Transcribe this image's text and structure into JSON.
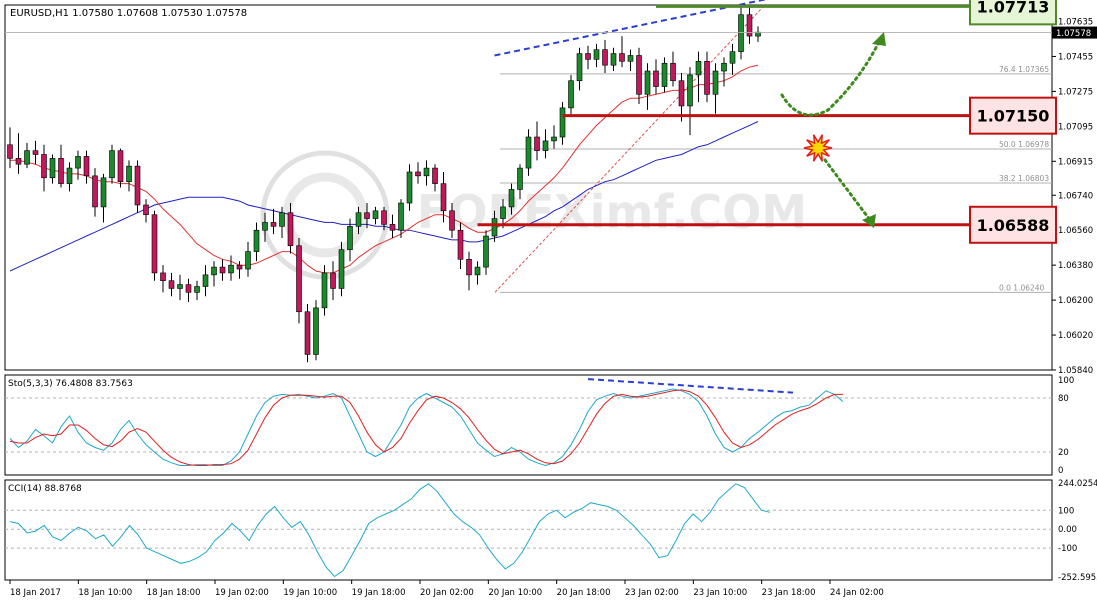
{
  "header": {
    "symbol_line": "EURUSD,H1  1.07580 1.07608 1.07530 1.07578"
  },
  "watermark": "FOREXimf.COM",
  "colors": {
    "bull": "#1a8a2a",
    "bear": "#c2185b",
    "ma_fast": "#e03030",
    "ma_slow": "#2020c0",
    "trend": "#2a3fd0",
    "green_level": "#4f8a2a",
    "red_level": "#c01010",
    "stoch_k": "#20a8c8",
    "stoch_d": "#e02020",
    "cci": "#20a8c8",
    "fib": "#e05050"
  },
  "chart_data": [
    {
      "type": "candlestick",
      "name": "price",
      "ylim": [
        1.0584,
        1.0772
      ],
      "y_ticks": [
        "1.07635",
        "1.07455",
        "1.07275",
        "1.07095",
        "1.06915",
        "1.06740",
        "1.06560",
        "1.06380",
        "1.06200",
        "1.06020",
        "1.05840"
      ],
      "current_price": "1.07578",
      "ohlc": [
        [
          1.07,
          1.0709,
          1.0688,
          1.0693
        ],
        [
          1.0693,
          1.0706,
          1.0685,
          1.069
        ],
        [
          1.069,
          1.0701,
          1.0688,
          1.0697
        ],
        [
          1.0697,
          1.0702,
          1.069,
          1.0695
        ],
        [
          1.0695,
          1.07,
          1.0676,
          1.0683
        ],
        [
          1.0683,
          1.0695,
          1.068,
          1.0693
        ],
        [
          1.0693,
          1.07,
          1.0678,
          1.068
        ],
        [
          1.068,
          1.0691,
          1.0676,
          1.0688
        ],
        [
          1.0688,
          1.0697,
          1.0682,
          1.0694
        ],
        [
          1.0694,
          1.0697,
          1.068,
          1.0684
        ],
        [
          1.0684,
          1.0688,
          1.0663,
          1.0668
        ],
        [
          1.0668,
          1.0685,
          1.066,
          1.0683
        ],
        [
          1.0683,
          1.07,
          1.068,
          1.0697
        ],
        [
          1.0697,
          1.0698,
          1.0678,
          1.0681
        ],
        [
          1.0681,
          1.0692,
          1.0676,
          1.0689
        ],
        [
          1.0689,
          1.0692,
          1.0665,
          1.0669
        ],
        [
          1.0669,
          1.0672,
          1.066,
          1.0664
        ],
        [
          1.0664,
          1.0666,
          1.063,
          1.0634
        ],
        [
          1.0634,
          1.0638,
          1.0624,
          1.063
        ],
        [
          1.063,
          1.0634,
          1.0622,
          1.0626
        ],
        [
          1.0626,
          1.0633,
          1.062,
          1.0628
        ],
        [
          1.0628,
          1.0631,
          1.0619,
          1.0624
        ],
        [
          1.0624,
          1.063,
          1.062,
          1.0627
        ],
        [
          1.0627,
          1.0638,
          1.0622,
          1.0633
        ],
        [
          1.0633,
          1.064,
          1.0627,
          1.0637
        ],
        [
          1.0637,
          1.0641,
          1.063,
          1.0634
        ],
        [
          1.0634,
          1.0643,
          1.063,
          1.0638
        ],
        [
          1.0638,
          1.064,
          1.0631,
          1.0636
        ],
        [
          1.0636,
          1.065,
          1.0632,
          1.0645
        ],
        [
          1.0645,
          1.066,
          1.064,
          1.0656
        ],
        [
          1.0656,
          1.0665,
          1.065,
          1.066
        ],
        [
          1.066,
          1.0667,
          1.0654,
          1.0658
        ],
        [
          1.0658,
          1.0668,
          1.0652,
          1.0665
        ],
        [
          1.0665,
          1.067,
          1.0644,
          1.0648
        ],
        [
          1.0648,
          1.0652,
          1.0608,
          1.0614
        ],
        [
          1.0614,
          1.0618,
          1.0588,
          1.0592
        ],
        [
          1.0592,
          1.062,
          1.0589,
          1.0616
        ],
        [
          1.0616,
          1.0638,
          1.0612,
          1.0634
        ],
        [
          1.0634,
          1.064,
          1.062,
          1.0626
        ],
        [
          1.0626,
          1.065,
          1.0622,
          1.0646
        ],
        [
          1.0646,
          1.0662,
          1.064,
          1.0658
        ],
        [
          1.0658,
          1.0668,
          1.0654,
          1.0665
        ],
        [
          1.0665,
          1.067,
          1.0657,
          1.0662
        ],
        [
          1.0662,
          1.0668,
          1.0659,
          1.0666
        ],
        [
          1.0666,
          1.0668,
          1.0656,
          1.0659
        ],
        [
          1.0659,
          1.0664,
          1.0652,
          1.0656
        ],
        [
          1.0656,
          1.0672,
          1.0652,
          1.067
        ],
        [
          1.067,
          1.069,
          1.0666,
          1.0686
        ],
        [
          1.0686,
          1.0691,
          1.068,
          1.0684
        ],
        [
          1.0684,
          1.0692,
          1.0679,
          1.0688
        ],
        [
          1.0688,
          1.069,
          1.0676,
          1.068
        ],
        [
          1.068,
          1.0686,
          1.066,
          1.0666
        ],
        [
          1.0666,
          1.067,
          1.0652,
          1.0656
        ],
        [
          1.0656,
          1.066,
          1.0636,
          1.0641
        ],
        [
          1.0641,
          1.0645,
          1.0625,
          1.0633
        ],
        [
          1.0633,
          1.064,
          1.0628,
          1.0637
        ],
        [
          1.0637,
          1.0656,
          1.0633,
          1.0653
        ],
        [
          1.0653,
          1.0666,
          1.065,
          1.0662
        ],
        [
          1.0662,
          1.0672,
          1.0657,
          1.0668
        ],
        [
          1.0668,
          1.068,
          1.0664,
          1.0677
        ],
        [
          1.0677,
          1.069,
          1.0672,
          1.0688
        ],
        [
          1.0688,
          1.0708,
          1.0684,
          1.0704
        ],
        [
          1.0704,
          1.0712,
          1.0692,
          1.0697
        ],
        [
          1.0697,
          1.0708,
          1.0693,
          1.0702
        ],
        [
          1.0702,
          1.071,
          1.0698,
          1.0704
        ],
        [
          1.0704,
          1.0722,
          1.07,
          1.0719
        ],
        [
          1.0719,
          1.0736,
          1.0715,
          1.0733
        ],
        [
          1.0733,
          1.075,
          1.0728,
          1.0747
        ],
        [
          1.0747,
          1.0751,
          1.0739,
          1.0744
        ],
        [
          1.0744,
          1.0752,
          1.074,
          1.0749
        ],
        [
          1.0749,
          1.0754,
          1.0737,
          1.0741
        ],
        [
          1.0741,
          1.075,
          1.0738,
          1.0747
        ],
        [
          1.0747,
          1.0756,
          1.074,
          1.0743
        ],
        [
          1.0743,
          1.0749,
          1.0738,
          1.0746
        ],
        [
          1.0746,
          1.075,
          1.0721,
          1.0726
        ],
        [
          1.0726,
          1.0742,
          1.0718,
          1.0738
        ],
        [
          1.0738,
          1.0744,
          1.0726,
          1.073
        ],
        [
          1.073,
          1.0745,
          1.0727,
          1.0742
        ],
        [
          1.0742,
          1.0748,
          1.073,
          1.0733
        ],
        [
          1.0733,
          1.0737,
          1.0712,
          1.072
        ],
        [
          1.072,
          1.074,
          1.0705,
          1.0736
        ],
        [
          1.0736,
          1.0748,
          1.0722,
          1.0743
        ],
        [
          1.0743,
          1.0748,
          1.0722,
          1.0726
        ],
        [
          1.0726,
          1.0742,
          1.0716,
          1.0738
        ],
        [
          1.0738,
          1.0745,
          1.073,
          1.0742
        ],
        [
          1.0742,
          1.0752,
          1.0736,
          1.0748
        ],
        [
          1.0748,
          1.0771,
          1.0744,
          1.0767
        ],
        [
          1.0767,
          1.0771,
          1.0752,
          1.0756
        ],
        [
          1.0756,
          1.0761,
          1.0753,
          1.0758
        ]
      ],
      "ma_fast": [
        1.0692,
        1.0692,
        1.0691,
        1.069,
        1.0688,
        1.0687,
        1.0686,
        1.0685,
        1.0685,
        1.0684,
        1.0682,
        1.0681,
        1.0681,
        1.068,
        1.068,
        1.0678,
        1.0676,
        1.0672,
        1.0667,
        1.0663,
        1.0659,
        1.0654,
        1.0649,
        1.0646,
        1.0643,
        1.0641,
        1.064,
        1.0638,
        1.0638,
        1.0639,
        1.0641,
        1.0643,
        1.0645,
        1.0645,
        1.0642,
        1.0638,
        1.0635,
        1.0634,
        1.0634,
        1.0636,
        1.0638,
        1.0642,
        1.0645,
        1.0648,
        1.065,
        1.0652,
        1.0654,
        1.0657,
        1.066,
        1.0662,
        1.0664,
        1.0664,
        1.0662,
        1.066,
        1.0657,
        1.0655,
        1.0655,
        1.0657,
        1.0659,
        1.0662,
        1.0666,
        1.0671,
        1.0675,
        1.0679,
        1.0683,
        1.0688,
        1.0694,
        1.07,
        1.0705,
        1.071,
        1.0714,
        1.0718,
        1.0722,
        1.0724,
        1.0724,
        1.0725,
        1.0726,
        1.0727,
        1.0728,
        1.0728,
        1.0729,
        1.0731,
        1.0731,
        1.0732,
        1.0733,
        1.0735,
        1.0738,
        1.074,
        1.0741
      ],
      "ma_slow": [
        1.0635,
        1.0637,
        1.0639,
        1.0641,
        1.0643,
        1.0645,
        1.0647,
        1.0649,
        1.0651,
        1.0653,
        1.0655,
        1.0657,
        1.0659,
        1.0661,
        1.0663,
        1.0665,
        1.0667,
        1.0669,
        1.067,
        1.0671,
        1.0672,
        1.0673,
        1.0673,
        1.0673,
        1.0673,
        1.0673,
        1.0672,
        1.0671,
        1.0669,
        1.0668,
        1.0667,
        1.0666,
        1.0665,
        1.0664,
        1.0663,
        1.0662,
        1.0661,
        1.066,
        1.066,
        1.0659,
        1.0659,
        1.0659,
        1.0659,
        1.0658,
        1.0658,
        1.0657,
        1.0656,
        1.0656,
        1.0655,
        1.0654,
        1.0653,
        1.0652,
        1.0651,
        1.0651,
        1.065,
        1.065,
        1.0651,
        1.0652,
        1.0653,
        1.0655,
        1.0657,
        1.0659,
        1.0661,
        1.0663,
        1.0666,
        1.0668,
        1.0671,
        1.0674,
        1.0677,
        1.0679,
        1.0681,
        1.0682,
        1.0684,
        1.0686,
        1.0688,
        1.069,
        1.0692,
        1.0693,
        1.0694,
        1.0695,
        1.0697,
        1.0699,
        1.07,
        1.0702,
        1.0704,
        1.0706,
        1.0708,
        1.071,
        1.0712
      ],
      "fibonacci": [
        {
          "label": "76.4  1.07365",
          "value": 1.07365
        },
        {
          "label": "50.0  1.06978",
          "value": 1.06978
        },
        {
          "label": "38.2  1.06803",
          "value": 1.06803
        },
        {
          "label": "0.0  1.06240",
          "value": 1.0624
        }
      ],
      "levels": [
        {
          "name": "resistance",
          "label": "1.07713",
          "value": 1.07713,
          "color": "#4f8a2a",
          "start_bar": 76
        },
        {
          "name": "pivot",
          "label": "1.07150",
          "value": 1.0715,
          "color": "#c01010",
          "start_bar": 65
        },
        {
          "name": "support",
          "label": "1.06588",
          "value": 1.06588,
          "color": "#c01010",
          "start_bar": 55
        }
      ],
      "trendline": {
        "start_bar": 57,
        "start_value": 1.0746,
        "end_bar": 89,
        "end_value": 1.0775
      }
    },
    {
      "type": "line",
      "name": "stochastic",
      "label": "Sto(5,3,3) 76.4808 83.7563",
      "ylim": [
        0,
        100
      ],
      "y_ticks": [
        "100",
        "80",
        "20",
        "0"
      ],
      "series": [
        {
          "name": "%K",
          "values": [
            35,
            25,
            32,
            45,
            38,
            30,
            48,
            60,
            42,
            30,
            25,
            22,
            30,
            45,
            55,
            40,
            28,
            20,
            12,
            8,
            5,
            5,
            6,
            6,
            5,
            5,
            10,
            20,
            40,
            60,
            75,
            82,
            84,
            83,
            84,
            82,
            80,
            82,
            85,
            80,
            60,
            40,
            20,
            15,
            20,
            35,
            50,
            70,
            80,
            85,
            80,
            75,
            70,
            60,
            45,
            30,
            22,
            15,
            18,
            25,
            20,
            12,
            8,
            5,
            8,
            15,
            28,
            45,
            65,
            78,
            82,
            85,
            82,
            80,
            82,
            84,
            86,
            88,
            90,
            88,
            84,
            76,
            60,
            40,
            25,
            20,
            25,
            35,
            42,
            50,
            58,
            64,
            66,
            70,
            72,
            80,
            88,
            84,
            76
          ]
        },
        {
          "name": "%D",
          "values": [
            32,
            30,
            30,
            36,
            40,
            38,
            40,
            50,
            50,
            44,
            35,
            28,
            26,
            32,
            42,
            46,
            42,
            32,
            22,
            14,
            9,
            6,
            5,
            5,
            6,
            6,
            7,
            12,
            22,
            40,
            58,
            72,
            80,
            83,
            83,
            83,
            82,
            81,
            82,
            82,
            75,
            60,
            42,
            28,
            20,
            25,
            35,
            52,
            66,
            78,
            82,
            80,
            75,
            68,
            58,
            45,
            33,
            23,
            18,
            20,
            22,
            18,
            12,
            8,
            7,
            10,
            18,
            30,
            46,
            62,
            74,
            82,
            84,
            82,
            81,
            82,
            84,
            86,
            88,
            89,
            87,
            82,
            72,
            58,
            42,
            30,
            25,
            28,
            34,
            42,
            50,
            56,
            62,
            66,
            69,
            74,
            80,
            84,
            84
          ]
        }
      ]
    },
    {
      "type": "line",
      "name": "cci",
      "label": "CCI(14) 88.8768",
      "ylim": [
        -252.5955,
        244.0254
      ],
      "y_ticks": [
        "244.0254",
        "100",
        "0.00",
        "-100",
        "-252.5955"
      ],
      "series": [
        {
          "name": "CCI(14)",
          "values": [
            40,
            30,
            -20,
            -10,
            20,
            -40,
            -60,
            -20,
            10,
            -10,
            -50,
            -30,
            -90,
            -40,
            20,
            -30,
            -100,
            -120,
            -140,
            -160,
            -180,
            -170,
            -150,
            -120,
            -60,
            -20,
            30,
            -10,
            -60,
            20,
            80,
            120,
            60,
            10,
            40,
            -30,
            -120,
            -200,
            -250,
            -220,
            -140,
            -60,
            30,
            60,
            80,
            100,
            130,
            160,
            210,
            240,
            200,
            140,
            80,
            40,
            10,
            -30,
            -100,
            -160,
            -210,
            -180,
            -120,
            -40,
            40,
            80,
            100,
            60,
            90,
            110,
            140,
            130,
            120,
            100,
            60,
            20,
            -30,
            -80,
            -150,
            -140,
            -60,
            30,
            80,
            40,
            90,
            160,
            200,
            240,
            220,
            160,
            100,
            89
          ]
        }
      ]
    }
  ],
  "x_labels": [
    "18 Jan 2017",
    "18 Jan 10:00",
    "18 Jan 18:00",
    "19 Jan 02:00",
    "19 Jan 10:00",
    "19 Jan 18:00",
    "20 Jan 02:00",
    "20 Jan 10:00",
    "20 Jan 18:00",
    "23 Jan 02:00",
    "23 Jan 10:00",
    "23 Jan 18:00",
    "24 Jan 02:00"
  ]
}
